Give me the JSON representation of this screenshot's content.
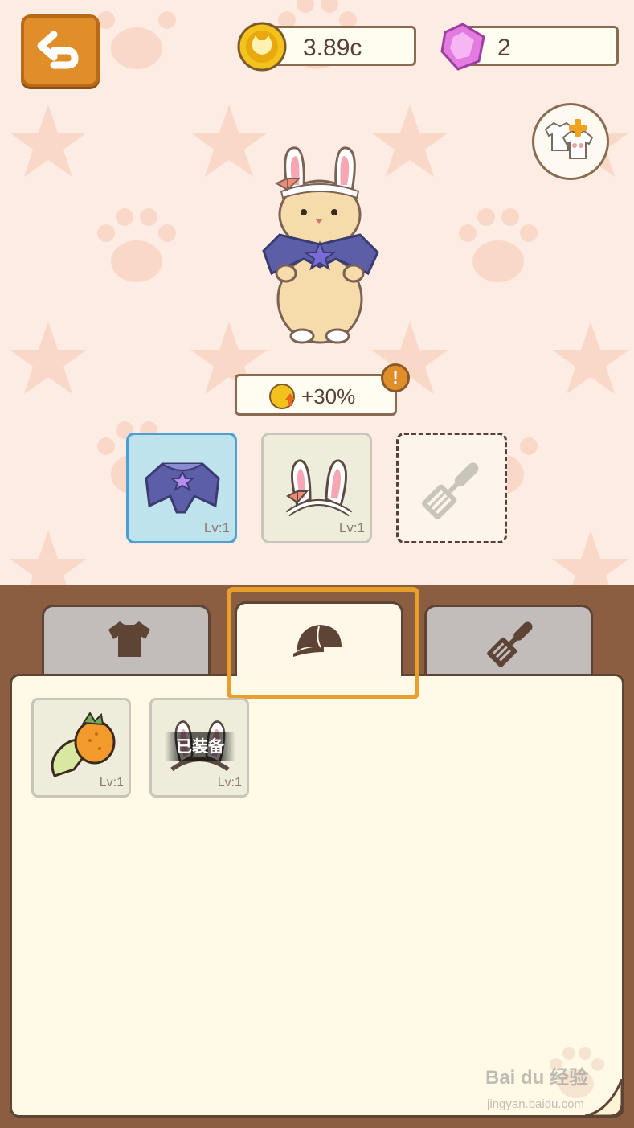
{
  "header": {
    "back_icon": "back-arrow-icon",
    "coins": "3.89c",
    "gems": "2"
  },
  "character": {
    "name_icon": "bunny-cat-character",
    "bonus": "+30%"
  },
  "equip_slots": [
    {
      "icon": "cape-icon",
      "level": "Lv:1",
      "state": "selected"
    },
    {
      "icon": "bunny-ears-icon",
      "level": "Lv:1",
      "state": "filled"
    },
    {
      "icon": "spatula-icon",
      "level": "",
      "state": "empty"
    }
  ],
  "tabs": [
    {
      "icon": "shirt-icon",
      "active": false
    },
    {
      "icon": "cap-icon",
      "active": true
    },
    {
      "icon": "spatula-icon",
      "active": false
    }
  ],
  "inventory": [
    {
      "icon": "carrot-hat-icon",
      "level": "Lv:1",
      "badge": ""
    },
    {
      "icon": "bunny-ears-icon",
      "level": "Lv:1",
      "badge": "已装备"
    }
  ],
  "watermark": {
    "logo": "Bai du 经验",
    "url": "jingyan.baidu.com"
  },
  "colors": {
    "accent_orange": "#e08e2a",
    "panel_brown": "#8b5e42",
    "selected_slot": "#bfe3ec"
  }
}
